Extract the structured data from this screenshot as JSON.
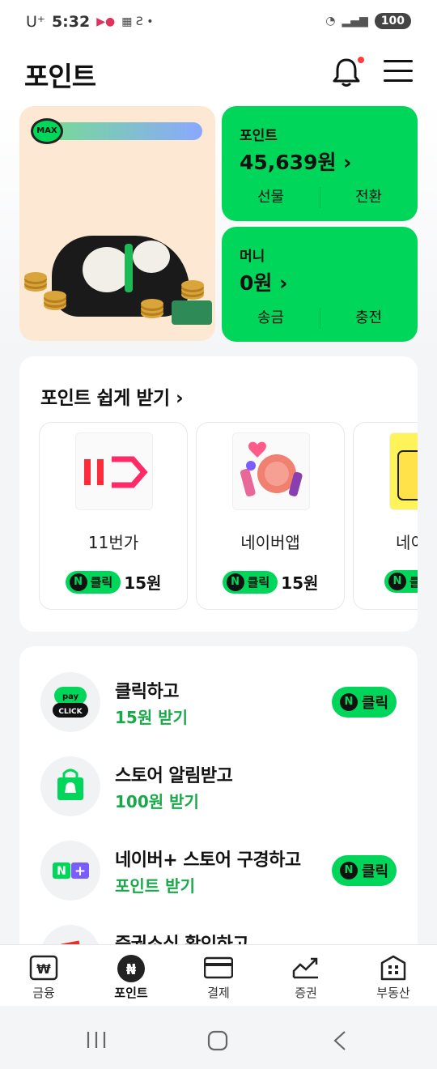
{
  "status": {
    "carrier": "U⁺",
    "time": "5:32",
    "battery": "100"
  },
  "header": {
    "title": "포인트"
  },
  "hero": {
    "badge": "MAX"
  },
  "point_card": {
    "label": "포인트",
    "amount": "45,639원 ›",
    "btn_left": "선물",
    "btn_right": "전환"
  },
  "money_card": {
    "label": "머니",
    "amount": "0원 ›",
    "btn_left": "송금",
    "btn_right": "충전"
  },
  "easy": {
    "heading": "포인트 쉽게 받기 ›",
    "cards": [
      {
        "name": "11번가",
        "pill": "클릭",
        "reward": "15원"
      },
      {
        "name": "네이버앱",
        "pill": "클릭",
        "reward": "15원"
      },
      {
        "name": "네이",
        "pill": "클",
        "reward": ""
      }
    ]
  },
  "list": {
    "items": [
      {
        "title": "클릭하고",
        "sub": "15원 받기",
        "button": "클릭",
        "icon": "npay-click-icon"
      },
      {
        "title": "스토어 알림받고",
        "sub": "100원 받기",
        "button": "",
        "icon": "store-bag-icon"
      },
      {
        "title": "네이버+ 스토어 구경하고",
        "sub": "포인트 받기",
        "button": "클릭",
        "icon": "naver-plus-icon"
      },
      {
        "title": "증권소식 확인하고",
        "sub": "",
        "button": "",
        "icon": "stock-icon"
      }
    ]
  },
  "nav": {
    "tabs": [
      {
        "label": "금융",
        "icon": "finance-icon"
      },
      {
        "label": "포인트",
        "icon": "point-icon",
        "active": true
      },
      {
        "label": "결제",
        "icon": "card-icon"
      },
      {
        "label": "증권",
        "icon": "stock-chart-icon"
      },
      {
        "label": "부동산",
        "icon": "building-icon"
      }
    ]
  },
  "colors": {
    "brand_green": "#00d75a",
    "accent_green_text": "#1aa84a",
    "notification_dot": "#ff3b3b"
  }
}
